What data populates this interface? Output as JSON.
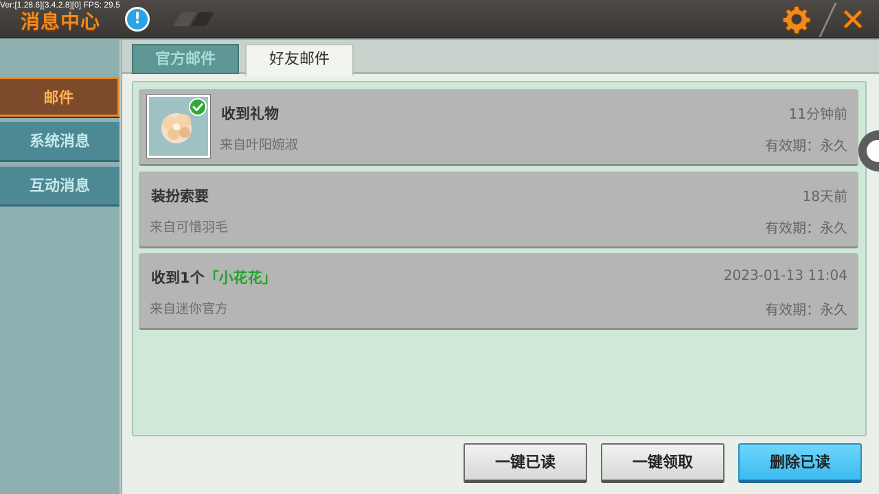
{
  "debug_overlay": "Ver:[1.28.6][3.4.2.8][0] FPS: 29.5",
  "header": {
    "title": "消息中心",
    "info_icon": "!",
    "colors": {
      "accent": "#f08a1e",
      "bar": "#3f3d39"
    }
  },
  "sidebar": {
    "items": [
      {
        "label": "邮件",
        "active": true
      },
      {
        "label": "系统消息",
        "active": false
      },
      {
        "label": "互动消息",
        "active": false
      }
    ]
  },
  "tabs": [
    {
      "label": "官方邮件",
      "active": false
    },
    {
      "label": "好友邮件",
      "active": true
    }
  ],
  "mails": [
    {
      "subject": "收到礼物",
      "from": "来自叶阳婉淑",
      "time": "11分钟前",
      "expiry": "有效期：永久",
      "has_attachment_thumb": true,
      "claimed": true
    },
    {
      "subject": "装扮索要",
      "from": "来自可惜羽毛",
      "time": "18天前",
      "expiry": "有效期：永久"
    },
    {
      "subject_prefix": "收到1个",
      "subject_highlight": "「小花花」",
      "from": "来自迷你官方",
      "time": "2023-01-13 11:04",
      "expiry": "有效期：永久"
    }
  ],
  "buttons": {
    "mark_all_read": "一键已读",
    "claim_all": "一键领取",
    "delete_read": "删除已读"
  },
  "icons": {
    "settings": "gear-icon",
    "close": "close-icon",
    "info": "info-icon",
    "check": "check-icon"
  }
}
